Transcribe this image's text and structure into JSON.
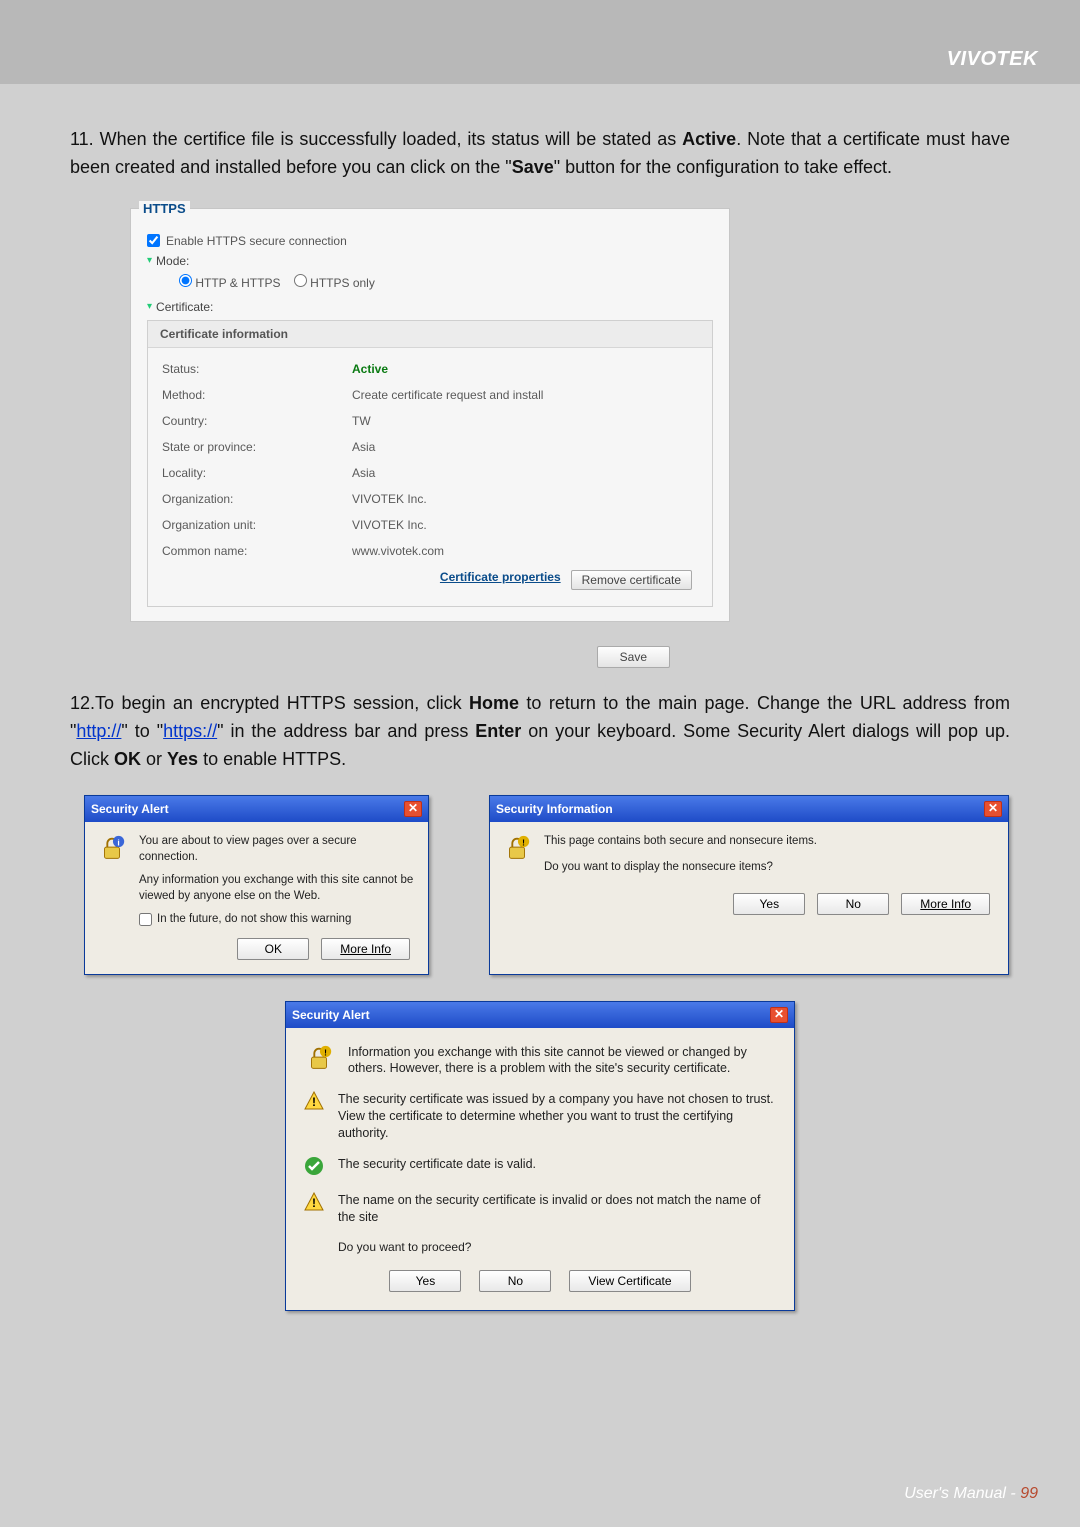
{
  "brand": "VIVOTEK",
  "step11": {
    "num": "11.",
    "text_a": "When the certifice file is successfully loaded, its status will be stated as ",
    "active": "Active",
    "text_b": ". Note that a certificate must have been created and installed before you can click on the \"",
    "save_word": "Save",
    "text_c": "\" button for the configuration to take effect."
  },
  "https_panel": {
    "legend": "HTTPS",
    "enable_label": "Enable HTTPS secure connection",
    "mode_label": "Mode:",
    "radio1": "HTTP & HTTPS",
    "radio2": "HTTPS only",
    "cert_label": "Certificate:",
    "cert_info_header": "Certificate information",
    "rows": [
      {
        "k": "Status:",
        "v": "Active",
        "active": true
      },
      {
        "k": "Method:",
        "v": "Create certificate request and install"
      },
      {
        "k": "Country:",
        "v": "TW"
      },
      {
        "k": "State or province:",
        "v": "Asia"
      },
      {
        "k": "Locality:",
        "v": "Asia"
      },
      {
        "k": "Organization:",
        "v": "VIVOTEK Inc."
      },
      {
        "k": "Organization unit:",
        "v": "VIVOTEK Inc."
      },
      {
        "k": "Common name:",
        "v": "www.vivotek.com"
      }
    ],
    "link_props": "Certificate properties",
    "btn_remove": "Remove certificate",
    "btn_save": "Save"
  },
  "step12": {
    "num": "12.",
    "a": "To begin an encrypted HTTPS session, click ",
    "home": "Home",
    "b": " to return to the main page. Change the URL address from \"",
    "http": "http://",
    "c": "\" to \"",
    "https": "https://",
    "d": "\" in the address bar and press ",
    "enter": "Enter",
    "e": " on your keyboard. Some Security Alert dialogs will pop up. Click ",
    "ok": "OK",
    "or": " or ",
    "yes": "Yes",
    "f": " to enable HTTPS."
  },
  "dlg1": {
    "title": "Security Alert",
    "line1": "You are about to view pages over a secure connection.",
    "line2": "Any information you exchange with this site cannot be viewed by anyone else on the Web.",
    "chk": "In the future, do not show this warning",
    "ok": "OK",
    "more": "More Info"
  },
  "dlg2": {
    "title": "Security Information",
    "line1": "This page contains both secure and nonsecure items.",
    "line2": "Do you want to display the nonsecure items?",
    "yes": "Yes",
    "no": "No",
    "more": "More Info"
  },
  "dlg3": {
    "title": "Security Alert",
    "intro": "Information you exchange with this site cannot be viewed or changed by others. However, there is a problem with the site's security certificate.",
    "w1": "The security certificate was issued by a company you have not chosen to trust. View the certificate to determine whether you want to trust the certifying authority.",
    "w2": "The security certificate date is valid.",
    "w3": "The name on the security certificate is invalid or does not match the name of the site",
    "proceed": "Do you want to proceed?",
    "yes": "Yes",
    "no": "No",
    "view": "View Certificate"
  },
  "footer": {
    "label": "User's Manual - ",
    "page": "99"
  }
}
